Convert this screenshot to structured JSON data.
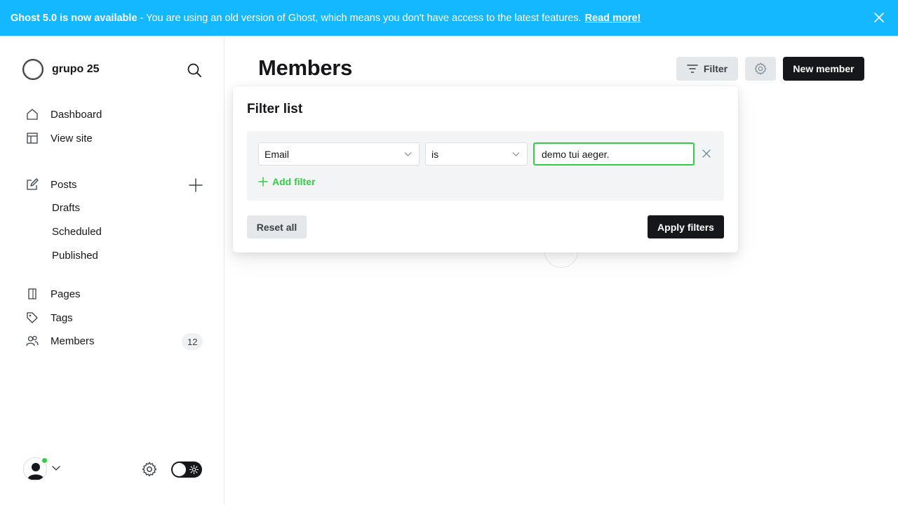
{
  "banner": {
    "title": "Ghost 5.0 is now available",
    "message": "- You are using an old version of Ghost, which means you don't have access to the latest features.",
    "link": "Read more!",
    "close_icon": "close-icon"
  },
  "sidebar": {
    "site_name": "grupo 25",
    "nav": [
      {
        "label": "Dashboard",
        "icon": "home-icon"
      },
      {
        "label": "View site",
        "icon": "layout-icon"
      },
      {
        "label": "Posts",
        "icon": "edit-icon"
      },
      {
        "label": "Pages",
        "icon": "page-icon"
      },
      {
        "label": "Tags",
        "icon": "tag-icon"
      },
      {
        "label": "Members",
        "icon": "members-icon",
        "count": "12"
      }
    ],
    "post_subitems": [
      "Drafts",
      "Scheduled",
      "Published"
    ]
  },
  "main": {
    "title": "Members",
    "filter_button": "Filter",
    "new_member_button": "New member"
  },
  "filter_popup": {
    "title": "Filter list",
    "field": "Email",
    "operator": "is",
    "value": "demo tui aeger.",
    "add_filter": "Add filter",
    "reset": "Reset all",
    "apply": "Apply filters"
  },
  "colors": {
    "banner": "#14b8ff",
    "accent_green": "#30cf43",
    "dark": "#15171a"
  }
}
